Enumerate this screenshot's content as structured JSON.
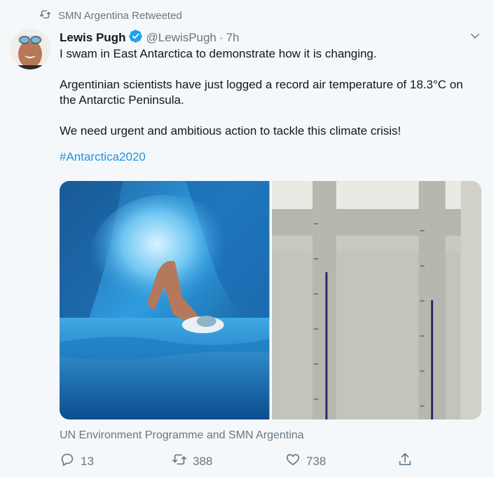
{
  "retweet": {
    "text": "SMN Argentina Retweeted",
    "icon": "retweet-icon"
  },
  "author": {
    "name": "Lewis Pugh",
    "handle": "@LewisPugh",
    "separator": "·",
    "time": "7h",
    "verified_icon": "verified-badge-icon",
    "avatar": "avatar"
  },
  "tweet": {
    "line1": "I swam in East Antarctica to demonstrate how it is changing.",
    "line2": "Argentinian scientists have just logged a record air temperature of 18.3°C on the Antarctic Peninsula.",
    "line3": "We need urgent and ambitious action to tackle this climate crisis!",
    "hashtag": "#Antarctica2020"
  },
  "media": {
    "left": "swimmer-ice-cave-photo",
    "right": "thermometer-photo"
  },
  "attribution": "UN Environment Programme and SMN Argentina",
  "actions": {
    "reply_count": "13",
    "retweet_count": "388",
    "like_count": "738"
  },
  "colors": {
    "background": "#f5f8fa",
    "text": "#14171a",
    "secondary": "#657786",
    "link": "#1b95e0",
    "verified": "#1da1f2"
  }
}
